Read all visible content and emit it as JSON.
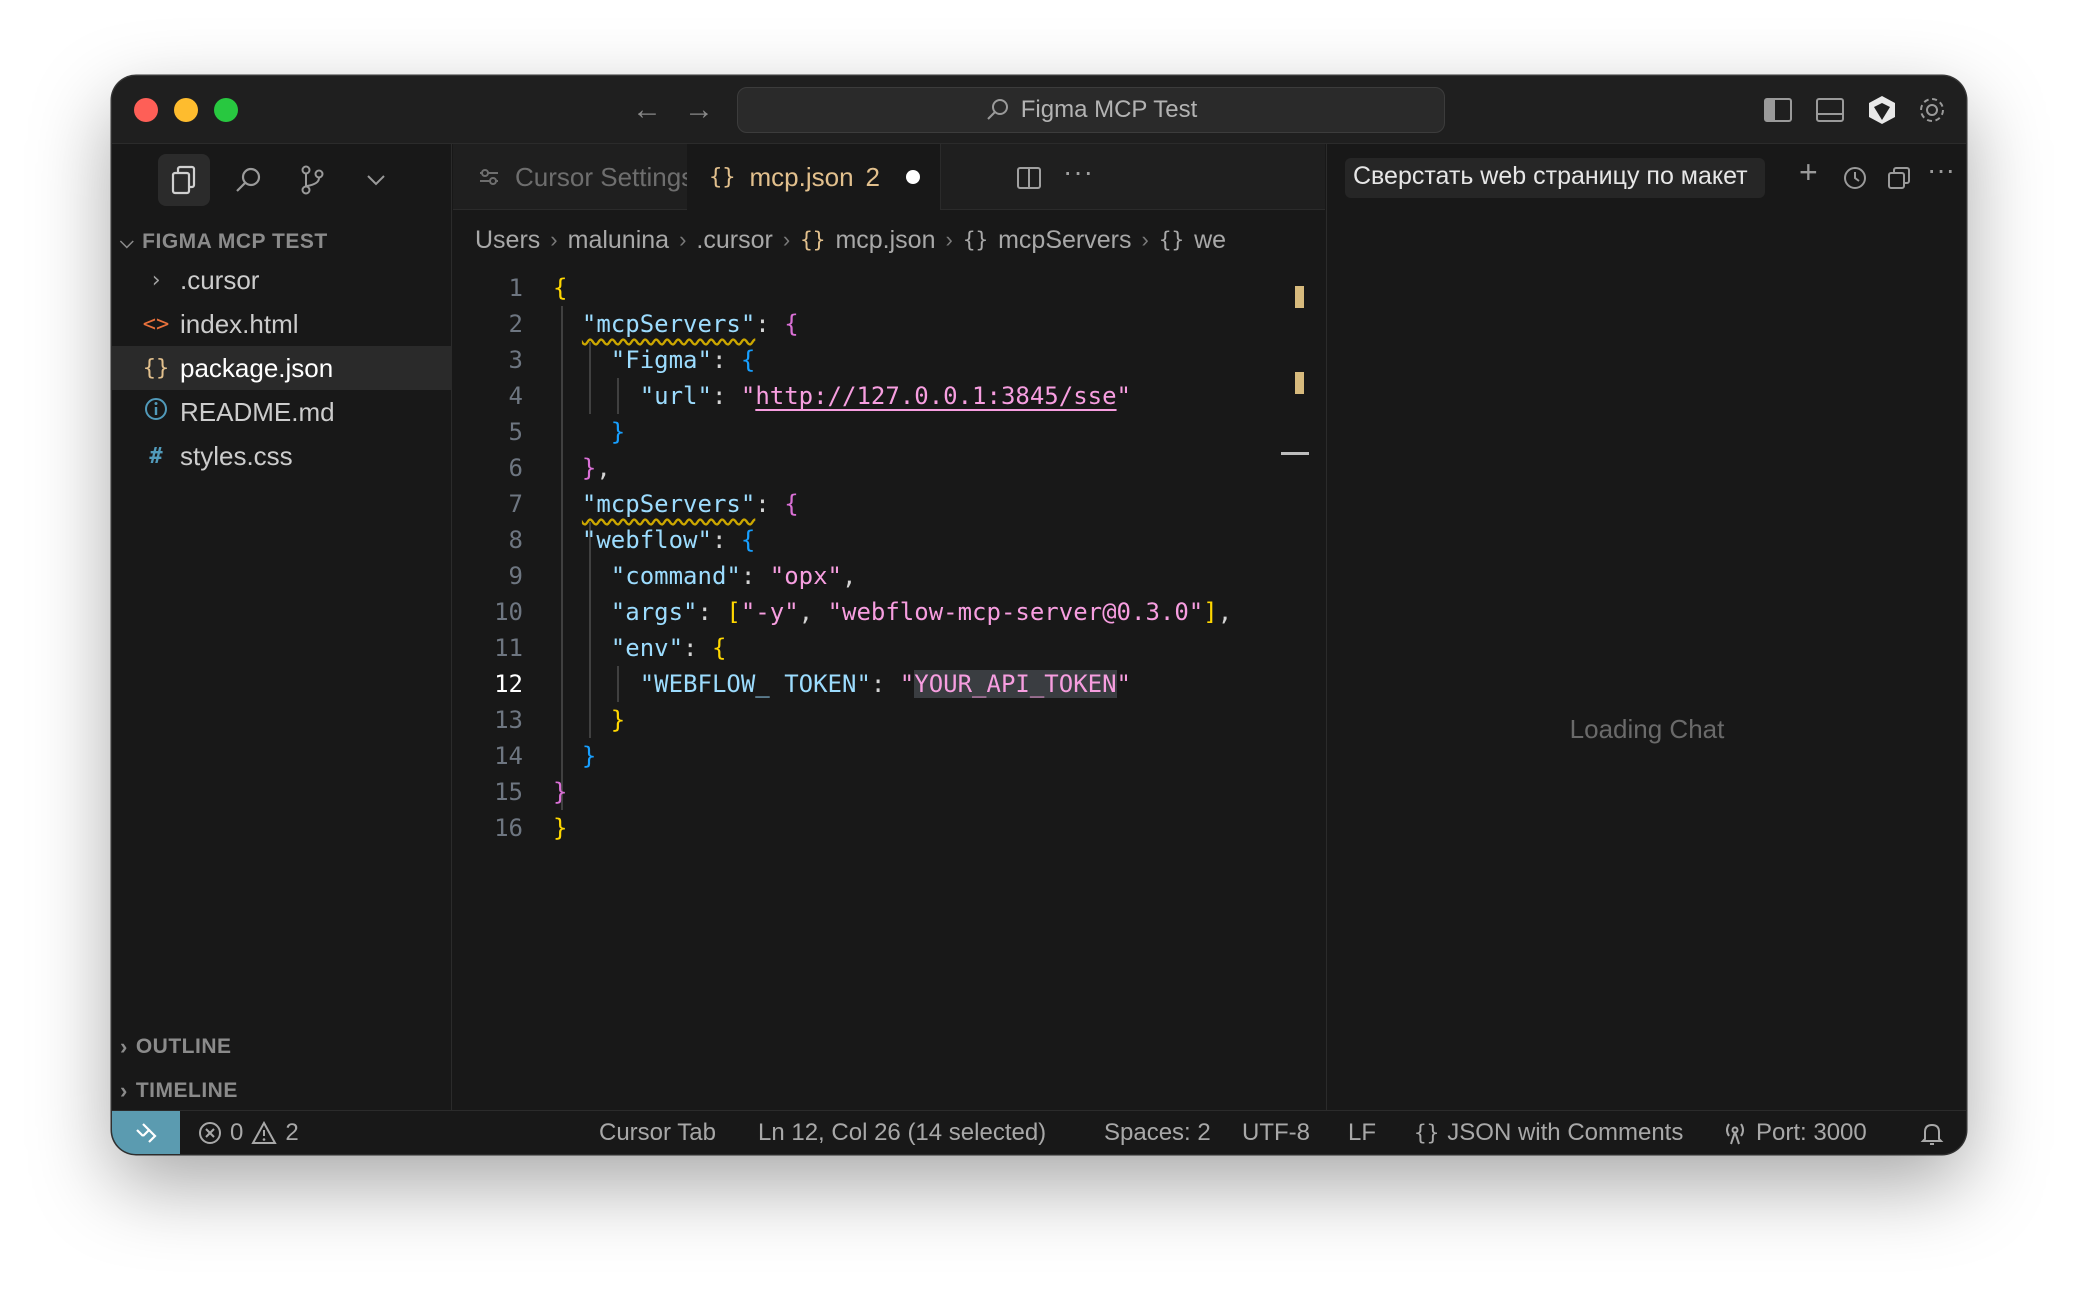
{
  "titlebar": {
    "search_text": "Figma MCP Test",
    "back_icon": "arrow-left-icon",
    "forward_icon": "arrow-right-icon"
  },
  "sidebar": {
    "project_title": "FIGMA MCP TEST",
    "files": [
      {
        "name": ".cursor",
        "icon": "chevron-right-icon"
      },
      {
        "name": "index.html",
        "icon": "html-icon"
      },
      {
        "name": "package.json",
        "icon": "json-icon"
      },
      {
        "name": "README.md",
        "icon": "info-icon"
      },
      {
        "name": "styles.css",
        "icon": "css-icon"
      }
    ],
    "outline_label": "OUTLINE",
    "timeline_label": "TIMELINE"
  },
  "editor": {
    "tabs": {
      "settings_label": "Cursor Settings",
      "active_label": "mcp.json",
      "active_problems": "2"
    },
    "breadcrumb": [
      "Users",
      "malunina",
      ".cursor",
      "mcp.json",
      "mcpServers",
      "we"
    ],
    "line_numbers": [
      "1",
      "2",
      "3",
      "4",
      "5",
      "6",
      "7",
      "8",
      "9",
      "10",
      "11",
      "12",
      "13",
      "14",
      "15",
      "16"
    ],
    "code": {
      "key_mcp": "\"mcpServers\"",
      "key_figma": "\"Figma\"",
      "key_url": "\"url\"",
      "val_url": "http://127.0.0.1:3845/sse",
      "key_webflow": "\"webflow\"",
      "key_command": "\"command\"",
      "val_command": "\"opx\"",
      "key_args": "\"args\"",
      "val_arg1": "\"-y\"",
      "val_arg2": "\"webflow-mcp-server@0.3.0\"",
      "key_env": "\"env\"",
      "key_token": "\"WEBFLOW_ TOKEN\"",
      "val_token": "YOUR_API_TOKEN"
    }
  },
  "chat": {
    "title": "Сверстать web страницу по макет",
    "loading": "Loading Chat"
  },
  "statusbar": {
    "errors": "0",
    "warnings": "2",
    "cursor_tab": "Cursor Tab",
    "position": "Ln 12, Col 26 (14 selected)",
    "spaces": "Spaces: 2",
    "encoding": "UTF-8",
    "eol": "LF",
    "language": "JSON with Comments",
    "port": "Port: 3000"
  }
}
